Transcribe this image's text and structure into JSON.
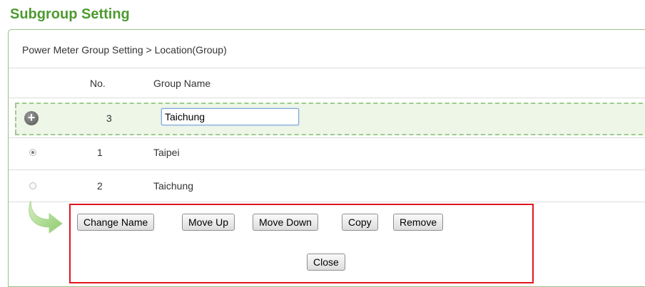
{
  "title": "Subgroup Setting",
  "breadcrumb": "Power Meter Group Setting > Location(Group)",
  "table": {
    "headers": {
      "no": "No.",
      "name": "Group Name"
    },
    "new_row": {
      "no": "3",
      "name_value": "Taichung"
    },
    "rows": [
      {
        "no": "1",
        "name": "Taipei",
        "selected": true
      },
      {
        "no": "2",
        "name": "Taichung",
        "selected": false
      }
    ]
  },
  "actions": {
    "change_name": "Change Name",
    "move_up": "Move Up",
    "move_down": "Move Down",
    "copy": "Copy",
    "remove": "Remove",
    "close": "Close"
  },
  "icons": {
    "add": "plus-circle-icon",
    "arrow": "curved-arrow-icon"
  },
  "colors": {
    "title": "#4d9a2f",
    "highlight_border": "#e0161e",
    "add_row_bg": "#eef6e8"
  }
}
